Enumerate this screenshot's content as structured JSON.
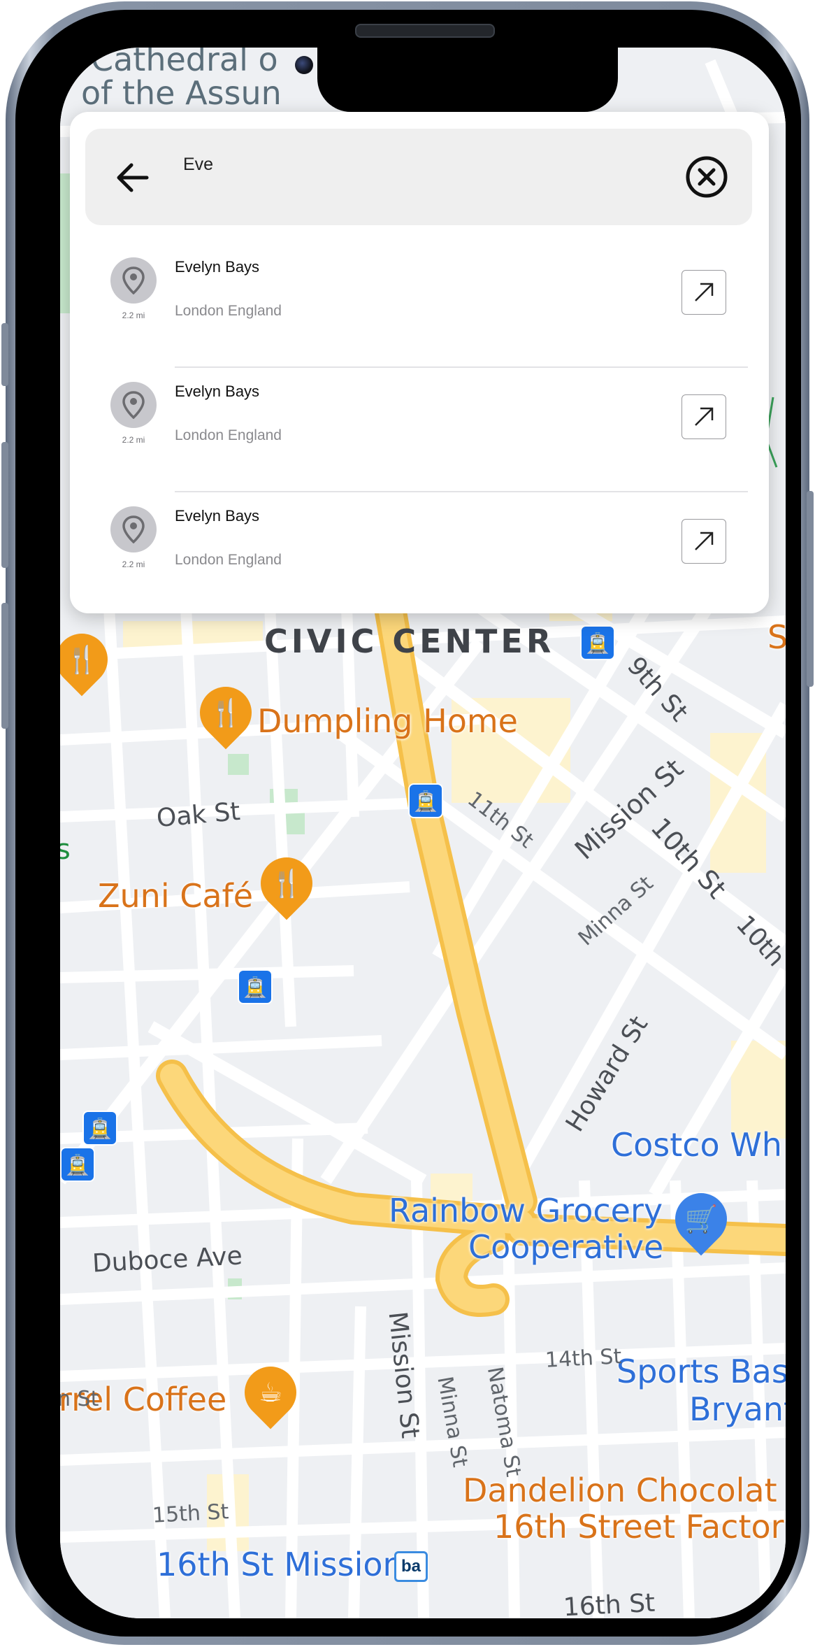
{
  "search": {
    "query": "Eve",
    "results": [
      {
        "title": "Evelyn Bays",
        "subtitle": "London England",
        "distance": "2.2 mi"
      },
      {
        "title": "Evelyn Bays",
        "subtitle": "London England",
        "distance": "2.2 mi"
      },
      {
        "title": "Evelyn Bays",
        "subtitle": "London England",
        "distance": "2.2 mi"
      }
    ]
  },
  "map": {
    "area_label": "CIVIC CENTER",
    "top_label_line1": "Cathedral o",
    "top_label_line2": "of the Assun",
    "roads": {
      "oak": "Oak St",
      "eleventh": "11th St",
      "mission_ne": "Mission St",
      "tenth": "10th St",
      "tenth_b": "10th",
      "ninth": "9th St",
      "minna_ne": "Minna St",
      "howard": "Howard St",
      "duboce": "Duboce Ave",
      "mission_s": "Mission St",
      "minna_s": "Minna St",
      "natoma": "Natoma St",
      "fourteenth": "14th St",
      "fifteenth": "15th St",
      "sixteenth": "16th St",
      "n_st": "n St",
      "s_left": "s"
    },
    "places": {
      "dumpling_home": "Dumpling Home",
      "zuni_cafe": "Zuni Café",
      "rainbow_l1": "Rainbow Grocery",
      "rainbow_l2": "Cooperative",
      "costco": "Costco Wh",
      "sports_l1": "Sports Bas",
      "sports_l2": "Bryant",
      "coffee": "rrel Coffee",
      "dandelion_l1": "Dandelion Chocolat",
      "dandelion_l2": "16th Street Factor",
      "mission_station": "16th St Mission",
      "bart_badge": "ba",
      "edge_s": "S"
    },
    "icons": {
      "restaurant": "fork-knife-icon",
      "cafe": "cup-icon",
      "shopping": "cart-icon",
      "transit": "tram-icon"
    },
    "colors": {
      "land": "#eef0f3",
      "road": "#ffffff",
      "highway": "#fcd77a",
      "poi_orange": "#f29b19",
      "poi_blue": "#1a73e8"
    }
  }
}
